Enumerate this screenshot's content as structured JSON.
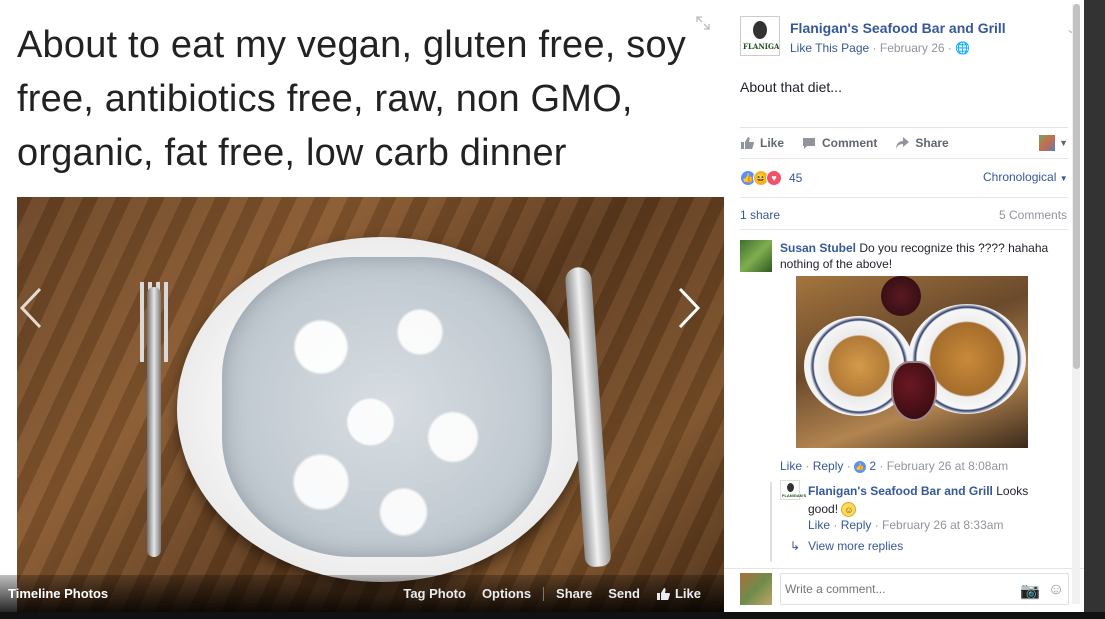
{
  "meme": {
    "line1": "About to eat my vegan, gluten free, soy",
    "line2": "free, antibiotics free, raw, non GMO,",
    "line3": "organic, fat free, low carb dinner"
  },
  "photo_bar": {
    "title": "Timeline Photos",
    "tag_photo": "Tag Photo",
    "options": "Options",
    "share": "Share",
    "send": "Send",
    "like": "Like"
  },
  "post": {
    "page_name": "Flanigan's Seafood Bar and Grill",
    "logo_text": "FLANIGAN'S",
    "like_page": "Like This Page",
    "date": "February 26",
    "caption": "About that diet..."
  },
  "actions": {
    "like": "Like",
    "comment": "Comment",
    "share": "Share"
  },
  "reactions": {
    "count": "45",
    "sort": "Chronological"
  },
  "stats": {
    "shares": "1 share",
    "comments": "5 Comments"
  },
  "comment": {
    "author": "Susan Stubel",
    "text": "Do you recognize this ???? hahaha nothing of the above!",
    "like": "Like",
    "reply": "Reply",
    "likes": "2",
    "time": "February 26 at 8:08am"
  },
  "reply": {
    "author": "Flanigan's Seafood Bar and Grill",
    "text": "Looks good!",
    "like": "Like",
    "reply": "Reply",
    "time": "February 26 at 8:33am"
  },
  "more_replies": "View more replies",
  "composer": {
    "placeholder": "Write a comment..."
  },
  "colors": {
    "link": "#365899",
    "meta": "#90949c",
    "like_blue": "#5890ff",
    "haha_yellow": "#f7b125",
    "love_red": "#f25268"
  }
}
